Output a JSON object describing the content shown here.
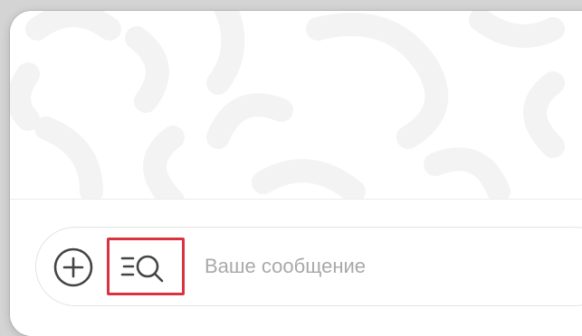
{
  "composer": {
    "placeholder": "Ваше сообщение",
    "attach_icon": "plus-circle-icon",
    "search_icon": "list-search-icon"
  },
  "colors": {
    "window_bg": "#ffffff",
    "backdrop": "#d4d4d4",
    "pattern": "#f3f3f3",
    "icon": "#444444",
    "highlight": "#d9333f",
    "placeholder": "#a9a9a9"
  }
}
